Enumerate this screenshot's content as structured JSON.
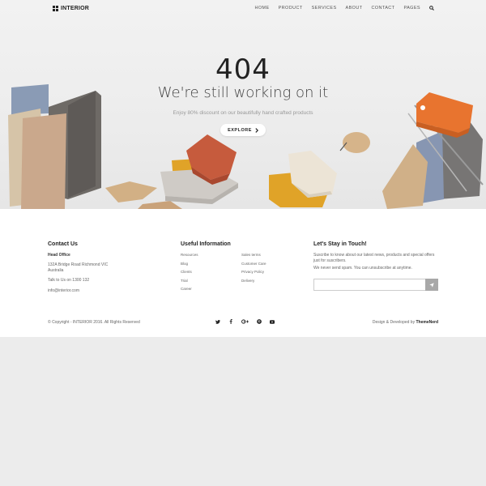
{
  "brand": {
    "logo_text": "INTERIOR"
  },
  "nav": {
    "items": [
      "HOME",
      "PRODUCT",
      "SERVICES",
      "ABOUT",
      "CONTACT",
      "PAGES"
    ],
    "search_icon": "search-icon"
  },
  "hero": {
    "code": "404",
    "title": "We're still working on it",
    "subtitle": "Enjoy 80% discount on our beautifully hand crafted products",
    "button_label": "EXPLORE"
  },
  "contact": {
    "heading": "Contact Us",
    "office_label": "Head Office",
    "address_line1": "132A Bridge Road Richmond VIC",
    "address_line2": "Australia",
    "phone": "Talk to Us on 1300 132",
    "email": "info@interior.com"
  },
  "useful": {
    "heading": "Useful Information",
    "col1": [
      "Resources",
      "Blog",
      "Clients",
      "Trial",
      "Career"
    ],
    "col2": [
      "Sales terms",
      "Customer Care",
      "Privacy Policy",
      "Delivery"
    ]
  },
  "newsletter": {
    "heading": "Let's Stay in Touch!",
    "text1": "Suscribe to know about our latest news, products and special offers just for suscribers.",
    "text2": "We never send spam. You can unsubscribe at anytime.",
    "input_placeholder": "",
    "send_icon": "send-icon"
  },
  "footer": {
    "copyright": "© Copyright - INTERIOR 2016. All Rights Reserved",
    "credit_prefix": "Design & Developed by",
    "credit_name": "ThemeNerd",
    "social": [
      "twitter-icon",
      "facebook-icon",
      "google-plus-icon",
      "pinterest-icon",
      "youtube-icon"
    ]
  },
  "colors": {
    "accent_orange": "#e8742f",
    "mustard": "#e0a328",
    "terracotta": "#c65b3d",
    "page_bg": "#ececec"
  }
}
